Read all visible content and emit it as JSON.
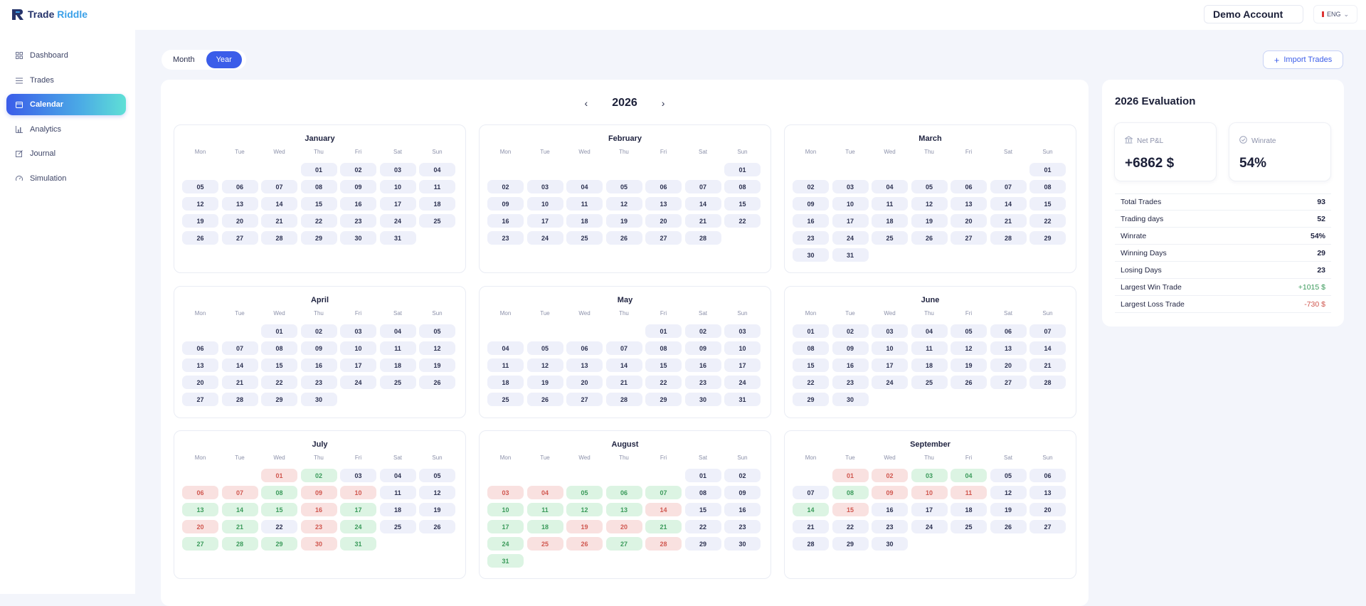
{
  "brand": {
    "name_part1": "Trade",
    "name_part2": "Riddle"
  },
  "account": {
    "label": "Demo Account"
  },
  "language": {
    "label": "ENG"
  },
  "sidebar": {
    "items": [
      {
        "label": "Dashboard",
        "icon": "grid-icon"
      },
      {
        "label": "Trades",
        "icon": "list-icon"
      },
      {
        "label": "Calendar",
        "icon": "calendar-icon",
        "active": true
      },
      {
        "label": "Analytics",
        "icon": "bar-chart-icon"
      },
      {
        "label": "Journal",
        "icon": "edit-icon"
      },
      {
        "label": "Simulation",
        "icon": "gauge-icon"
      }
    ]
  },
  "view_toggle": {
    "month_label": "Month",
    "year_label": "Year",
    "selected": "Year"
  },
  "import_button": {
    "label": "Import Trades"
  },
  "year_nav": {
    "year": "2026"
  },
  "weekdays": [
    "Mon",
    "Tue",
    "Wed",
    "Thu",
    "Fri",
    "Sat",
    "Sun"
  ],
  "colors": {
    "accent": "#3b5de9",
    "win": "#3a9a5a",
    "loss": "#d0574f"
  },
  "months": [
    {
      "name": "January",
      "offset": 3,
      "days": 31,
      "win": [],
      "loss": []
    },
    {
      "name": "February",
      "offset": 6,
      "days": 28,
      "win": [],
      "loss": []
    },
    {
      "name": "March",
      "offset": 6,
      "days": 31,
      "win": [],
      "loss": []
    },
    {
      "name": "April",
      "offset": 2,
      "days": 30,
      "win": [],
      "loss": []
    },
    {
      "name": "May",
      "offset": 4,
      "days": 31,
      "win": [],
      "loss": []
    },
    {
      "name": "June",
      "offset": 0,
      "days": 30,
      "win": [],
      "loss": []
    },
    {
      "name": "July",
      "offset": 2,
      "days": 31,
      "win": [
        2,
        8,
        13,
        14,
        15,
        17,
        21,
        24,
        27,
        28,
        29,
        31
      ],
      "loss": [
        1,
        6,
        7,
        9,
        10,
        16,
        20,
        23,
        30
      ]
    },
    {
      "name": "August",
      "offset": 5,
      "days": 31,
      "win": [
        5,
        6,
        7,
        10,
        11,
        12,
        13,
        17,
        18,
        21,
        24,
        27,
        31
      ],
      "loss": [
        3,
        4,
        14,
        19,
        20,
        25,
        26,
        28
      ]
    },
    {
      "name": "September",
      "offset": 1,
      "days": 30,
      "win": [
        3,
        4,
        8,
        14
      ],
      "loss": [
        1,
        2,
        9,
        10,
        11,
        15
      ]
    }
  ],
  "evaluation": {
    "title": "2026 Evaluation",
    "net_pl": {
      "label": "Net P&L",
      "value": "+6862 $"
    },
    "winrate": {
      "label": "Winrate",
      "value": "54%"
    },
    "stats": [
      {
        "label": "Total Trades",
        "value": "93",
        "tone": ""
      },
      {
        "label": "Trading days",
        "value": "52",
        "tone": ""
      },
      {
        "label": "Winrate",
        "value": "54%",
        "tone": ""
      },
      {
        "label": "Winning Days",
        "value": "29",
        "tone": ""
      },
      {
        "label": "Losing Days",
        "value": "23",
        "tone": ""
      },
      {
        "label": "Largest Win Trade",
        "value": "+1015 $",
        "tone": "pos"
      },
      {
        "label": "Largest Loss Trade",
        "value": "-730 $",
        "tone": "neg"
      }
    ]
  }
}
